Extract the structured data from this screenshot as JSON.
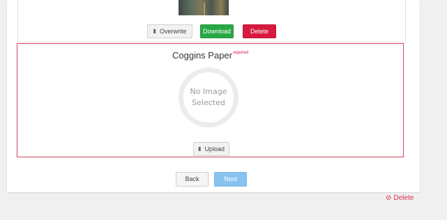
{
  "previous_card": {
    "overwrite_label": "Overwrite",
    "download_label": "Download",
    "delete_label": "Delete"
  },
  "coggins": {
    "title": "Coggins Paper",
    "required_label": "required",
    "placeholder_line1": "No Image",
    "placeholder_line2": "Selected",
    "upload_label": "Upload"
  },
  "footer": {
    "back_label": "Back",
    "next_label": "Next"
  },
  "side": {
    "delete_label": "Delete"
  },
  "colors": {
    "download": "#28a745",
    "delete": "#d7193e",
    "next": "#88c3f0",
    "required_border": "#d0485e"
  },
  "icons": {
    "file": "file-icon",
    "ban": "ban-icon"
  }
}
